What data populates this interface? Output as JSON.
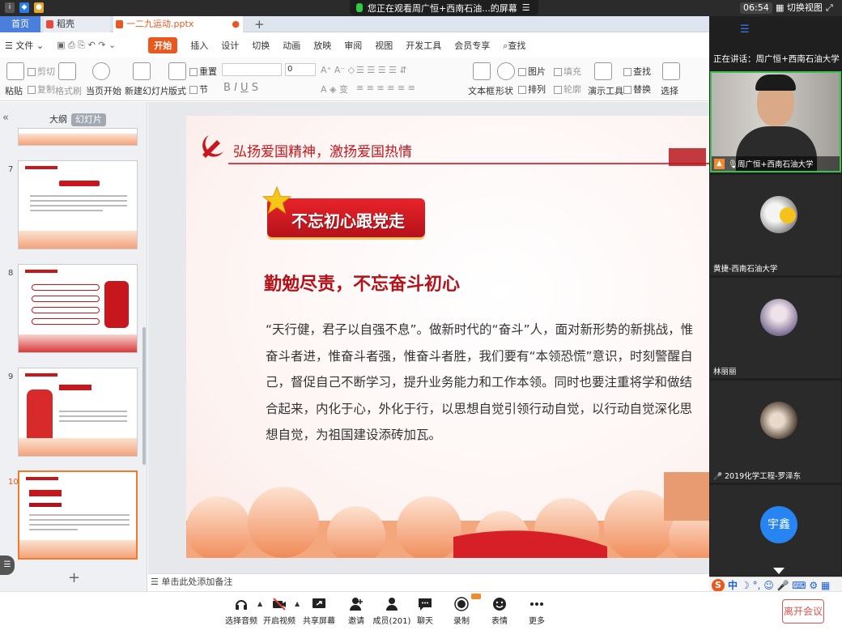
{
  "topbar": {
    "share_banner": "您正在观看周广恒+西南石油...的屏幕",
    "clock": "06:54",
    "switch_view": "切换视图"
  },
  "tabs": [
    {
      "label": "首页"
    },
    {
      "label": "稻壳"
    },
    {
      "label": "一二九运动.pptx"
    }
  ],
  "menu": {
    "file": "文件",
    "items": [
      "开始",
      "插入",
      "设计",
      "切换",
      "动画",
      "放映",
      "审阅",
      "视图",
      "开发工具",
      "会员专享"
    ],
    "search": "查找"
  },
  "ribbon": {
    "paste": "粘贴",
    "cut": "剪切",
    "copy": "复制",
    "format_painter": "格式刷",
    "play_from_current": "当页开始",
    "new_slide": "新建幻灯片",
    "layout": "版式",
    "section": "节",
    "reset": "重置",
    "font_size": "0",
    "text_box": "文本框",
    "shape": "形状",
    "picture": "图片",
    "fill": "填充",
    "arrange": "排列",
    "outline": "轮廓",
    "presentation_tools": "演示工具",
    "find": "查找",
    "replace": "替换",
    "select": "选择"
  },
  "left_panel": {
    "outline_tab": "大纲",
    "slides_tab": "幻灯片",
    "slide_numbers": [
      "7",
      "8",
      "9",
      "10"
    ],
    "notes_placeholder": "单击此处添加备注"
  },
  "slide": {
    "header": "弘扬爱国精神，激扬爱国热情",
    "banner": "不忘初心跟党走",
    "subtitle": "勤勉尽责，不忘奋斗初心",
    "body": "“天行健，君子以自强不息”。做新时代的“奋斗”人，面对新形势的新挑战，惟奋斗者进，惟奋斗者强，惟奋斗者胜，我们要有“本领恐慌”意识，时刻警醒自己，督促自己不断学习，提升业务能力和工作本领。同时也要注重将学和做结合起来，内化于心，外化于行，以思想自觉引领行动自觉，以行动自觉深化思想自觉，为祖国建设添砖加瓦。"
  },
  "meeting": {
    "speaking": "正在讲话：周广恒+西南石油大学",
    "participants": [
      {
        "name": "周广恒+西南石油大学"
      },
      {
        "name": "黄捷-西南石油大学"
      },
      {
        "name": "林丽丽"
      },
      {
        "name": "2019化学工程-罗泽东"
      },
      {
        "name": "宇鑫"
      }
    ]
  },
  "toolbar": {
    "audio": "选择音频",
    "video": "开启视频",
    "share": "共享屏幕",
    "invite": "邀请",
    "members": "成员(201)",
    "chat": "聊天",
    "record": "录制",
    "reactions": "表情",
    "more": "更多",
    "leave": "离开会议"
  },
  "ime": {
    "label": "中"
  },
  "colors": {
    "accent": "#e9581e",
    "party_red": "#c8161d",
    "dark": "#1f1f1f"
  }
}
